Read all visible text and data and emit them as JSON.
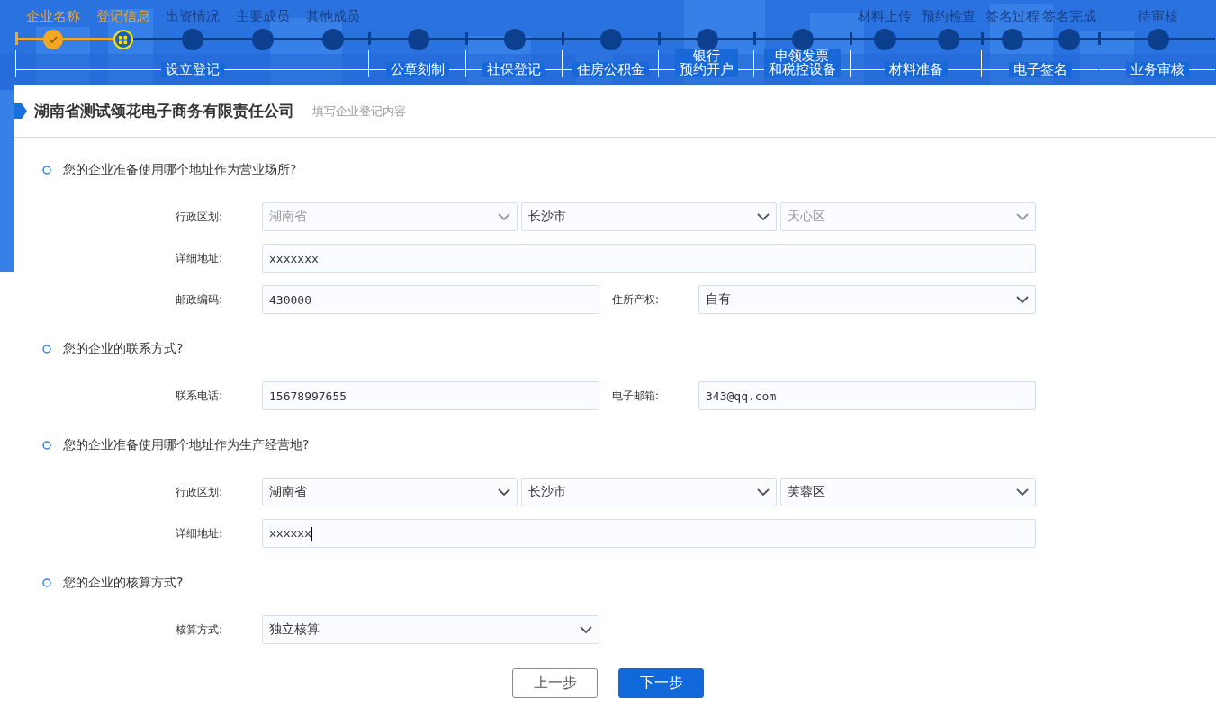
{
  "stepper": {
    "groups": [
      {
        "label": [
          "设立登记"
        ],
        "steps": [
          {
            "label": "企业名称",
            "selected": false
          },
          {
            "label": "登记信息",
            "selected": true
          },
          {
            "label": "出资情况",
            "selected": false
          },
          {
            "label": "主要成员",
            "selected": false
          },
          {
            "label": "其他成员",
            "selected": false
          }
        ]
      },
      {
        "label": [
          "公章刻制"
        ],
        "steps": [
          {
            "selected": false
          }
        ]
      },
      {
        "label": [
          "社保登记"
        ],
        "steps": [
          {
            "selected": false
          }
        ]
      },
      {
        "label": [
          "住房公积金"
        ],
        "steps": [
          {
            "selected": false
          }
        ]
      },
      {
        "label": [
          "银行",
          "预约开户"
        ],
        "steps": [
          {
            "selected": false
          }
        ]
      },
      {
        "label": [
          "申领发票",
          "和税控设备"
        ],
        "steps": [
          {
            "selected": false
          }
        ]
      },
      {
        "label": [
          "材料准备"
        ],
        "steps": [
          {
            "label": "材料上传",
            "selected": false
          },
          {
            "label": "预约检查",
            "selected": false
          }
        ]
      },
      {
        "label": [
          "电子签名"
        ],
        "steps": [
          {
            "label": "签名过程",
            "selected": false
          },
          {
            "label": "签名完成",
            "selected": false
          }
        ]
      },
      {
        "label": [
          "业务审核"
        ],
        "steps": [
          {
            "label": "待审核",
            "selected": false
          }
        ]
      }
    ]
  },
  "header": {
    "title": "湖南省测试颂花电子商务有限责任公司",
    "subtitle": "填写企业登记内容"
  },
  "sections": [
    {
      "question": "您的企业准备使用哪个地址作为营业场所?",
      "rows": [
        {
          "pairs": [
            {
              "label": "行政区划:",
              "fields": [
                {
                  "kind": "select",
                  "value": "湖南省",
                  "disabled": true
                },
                {
                  "kind": "select",
                  "value": "长沙市",
                  "disabled": false
                },
                {
                  "kind": "select",
                  "value": "天心区",
                  "disabled": true
                }
              ]
            }
          ]
        },
        {
          "pairs": [
            {
              "label": "详细地址:",
              "fields": [
                {
                  "kind": "input",
                  "value": "xxxxxxx",
                  "focused": false
                }
              ]
            }
          ]
        },
        {
          "pairs": [
            {
              "label": "邮政编码:",
              "fields": [
                {
                  "kind": "input",
                  "value": "430000",
                  "focused": false
                }
              ]
            },
            {
              "label": "住所产权:",
              "fields": [
                {
                  "kind": "select",
                  "value": "自有",
                  "disabled": false
                }
              ]
            }
          ]
        }
      ]
    },
    {
      "question": "您的企业的联系方式?",
      "rows": [
        {
          "pairs": [
            {
              "label": "联系电话:",
              "fields": [
                {
                  "kind": "input",
                  "value": "15678997655",
                  "focused": false
                }
              ]
            },
            {
              "label": "电子邮箱:",
              "fields": [
                {
                  "kind": "input",
                  "value": "343@qq.com",
                  "focused": false
                }
              ]
            }
          ]
        }
      ]
    },
    {
      "question": "您的企业准备使用哪个地址作为生产经营地?",
      "rows": [
        {
          "pairs": [
            {
              "label": "行政区划:",
              "fields": [
                {
                  "kind": "select",
                  "value": "湖南省",
                  "disabled": false
                },
                {
                  "kind": "select",
                  "value": "长沙市",
                  "disabled": false
                },
                {
                  "kind": "select",
                  "value": "芙蓉区",
                  "disabled": false
                }
              ]
            }
          ]
        },
        {
          "pairs": [
            {
              "label": "详细地址:",
              "fields": [
                {
                  "kind": "input",
                  "value": "xxxxxx",
                  "focused": true
                }
              ]
            }
          ]
        }
      ]
    },
    {
      "question": "您的企业的核算方式?",
      "rows": [
        {
          "pairs": [
            {
              "label": "核算方式:",
              "fields": [
                {
                  "kind": "select",
                  "value": "独立核算",
                  "disabled": false
                }
              ]
            }
          ]
        }
      ]
    }
  ],
  "buttons": [
    {
      "kind": "secondary",
      "label": "上一步"
    },
    {
      "kind": "primary",
      "label": "下一步"
    }
  ]
}
